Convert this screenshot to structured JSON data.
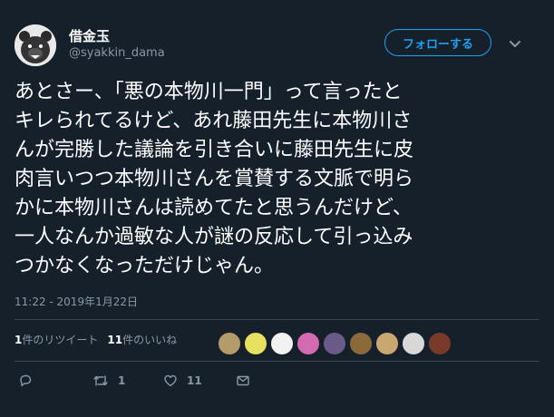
{
  "author": {
    "display_name": "借金玉",
    "handle": "@syakkin_dama",
    "avatar_icon": "bear-avatar"
  },
  "follow_button": {
    "label": "フォローする"
  },
  "menu_icon": "chevron-down-icon",
  "tweet": {
    "lines": [
      "あとさー、「悪の本物川一門」って言ったと",
      "キレられてるけど、あれ藤田先生に本物川さ",
      "んが完勝した議論を引き合いに藤田先生に皮",
      "肉言いつつ本物川さんを賞賛する文脈で明ら",
      "かに本物川さんは読めてたと思うんだけど、",
      "一人なんか過敏な人が謎の反応して引っ込み",
      "つかなくなっただけじゃん。"
    ],
    "timestamp": "11:22 - 2019年1月22日"
  },
  "stats": {
    "retweet_count": "1",
    "retweet_label": "件のリツイート",
    "like_count": "11",
    "like_label": "件のいいね"
  },
  "likers": [
    {
      "name": "liker-avatar-1",
      "color": "#b59a6a"
    },
    {
      "name": "liker-avatar-2",
      "color": "#e8e060"
    },
    {
      "name": "liker-avatar-3",
      "color": "#f2f2f2"
    },
    {
      "name": "liker-avatar-4",
      "color": "#d36bb0"
    },
    {
      "name": "liker-avatar-5",
      "color": "#6a5a8a"
    },
    {
      "name": "liker-avatar-6",
      "color": "#8a6a3a"
    },
    {
      "name": "liker-avatar-7",
      "color": "#c8a870"
    },
    {
      "name": "liker-avatar-8",
      "color": "#d8d8d8"
    },
    {
      "name": "liker-avatar-9",
      "color": "#7a3a2a"
    }
  ],
  "actions": {
    "reply_icon": "reply-icon",
    "retweet_icon": "retweet-icon",
    "retweet_count": "1",
    "like_icon": "heart-icon",
    "like_count": "11",
    "dm_icon": "mail-icon"
  },
  "colors": {
    "background": "#15202b",
    "accent": "#1da1f2",
    "secondary_text": "#8899a6",
    "divider": "#38444d"
  }
}
